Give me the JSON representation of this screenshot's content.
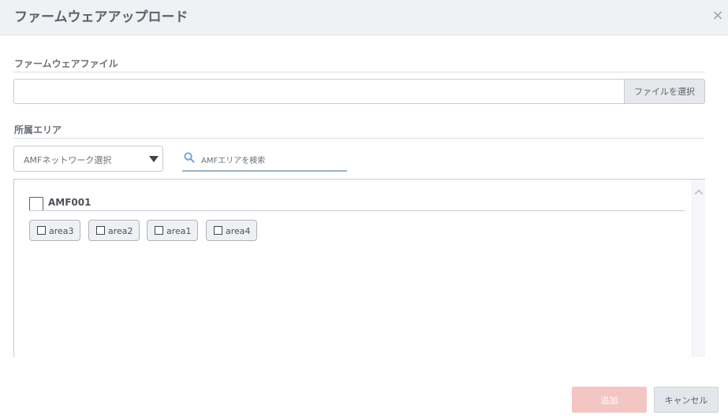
{
  "dialog": {
    "title": "ファームウェアアップロード",
    "close_symbol": "×"
  },
  "firmware_section": {
    "label": "ファームウェアファイル",
    "file_input_value": "",
    "select_file_button": "ファイルを選択"
  },
  "area_section": {
    "label": "所属エリア",
    "network_select": {
      "selected_label": "AMFネットワーク選択"
    },
    "search": {
      "icon": "search-icon",
      "placeholder": "AMFエリアを検索"
    },
    "groups": [
      {
        "name": "AMF001",
        "checked": false,
        "areas": [
          {
            "label": "area3",
            "checked": false
          },
          {
            "label": "area2",
            "checked": false
          },
          {
            "label": "area1",
            "checked": false
          },
          {
            "label": "area4",
            "checked": false
          }
        ]
      }
    ]
  },
  "footer": {
    "add_button": "追加",
    "cancel_button": "キャンセル"
  },
  "colors": {
    "header_bg": "#eff1f4",
    "add_button_disabled": "#f4c6c3",
    "search_underline": "#9fb1c4",
    "search_icon": "#6ea0d8"
  }
}
